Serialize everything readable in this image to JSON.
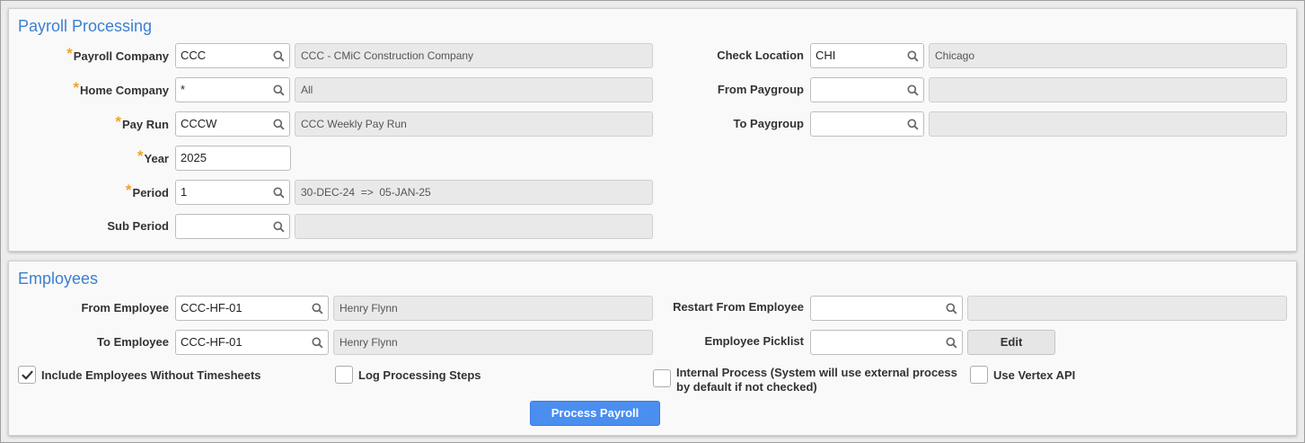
{
  "payroll": {
    "title": "Payroll Processing",
    "payroll_company": {
      "label": "Payroll Company",
      "value": "CCC",
      "desc": "CCC - CMiC Construction Company"
    },
    "home_company": {
      "label": "Home Company",
      "value": "*",
      "desc": "All"
    },
    "pay_run": {
      "label": "Pay Run",
      "value": "CCCW",
      "desc": "CCC Weekly Pay Run"
    },
    "year": {
      "label": "Year",
      "value": "2025"
    },
    "period": {
      "label": "Period",
      "value": "1",
      "desc": "30-DEC-24  =>  05-JAN-25"
    },
    "sub_period": {
      "label": "Sub Period",
      "value": "",
      "desc": ""
    },
    "check_location": {
      "label": "Check Location",
      "value": "CHI",
      "desc": "Chicago"
    },
    "from_paygroup": {
      "label": "From Paygroup",
      "value": "",
      "desc": ""
    },
    "to_paygroup": {
      "label": "To Paygroup",
      "value": "",
      "desc": ""
    },
    "required_mark": "*"
  },
  "employees": {
    "title": "Employees",
    "from_employee": {
      "label": "From Employee",
      "value": "CCC-HF-01",
      "desc": "Henry Flynn"
    },
    "to_employee": {
      "label": "To Employee",
      "value": "CCC-HF-01",
      "desc": "Henry Flynn"
    },
    "restart_from_employee": {
      "label": "Restart From Employee",
      "value": "",
      "desc": ""
    },
    "employee_picklist": {
      "label": "Employee Picklist",
      "value": "",
      "edit_label": "Edit"
    },
    "checkboxes": {
      "include_without_timesheets": {
        "label": "Include Employees Without Timesheets",
        "checked": true
      },
      "log_processing_steps": {
        "label": "Log Processing Steps",
        "checked": false
      },
      "internal_process": {
        "label_line1": "Internal Process (System will use external process",
        "label_line2": "by default if not checked)",
        "checked": false
      },
      "use_vertex_api": {
        "label": "Use Vertex API",
        "checked": false
      }
    },
    "process_button": "Process Payroll"
  },
  "colors": {
    "accent": "#3b7fd1",
    "required": "#f0a32a",
    "primary_button": "#4a8ef0"
  },
  "icons": {
    "lov": "magnifier-icon",
    "check": "checkmark-icon"
  }
}
